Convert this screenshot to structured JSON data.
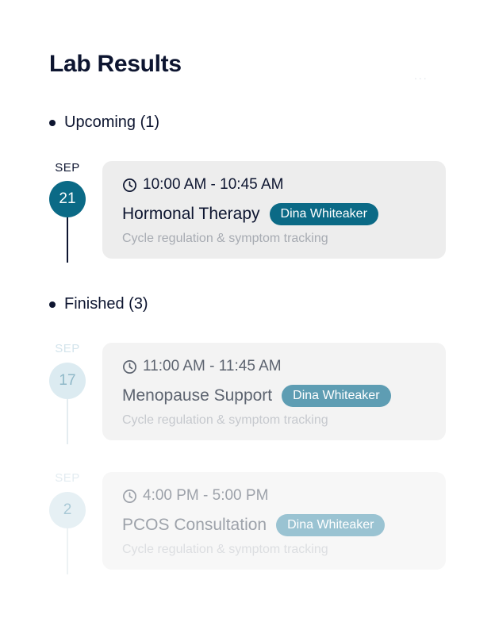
{
  "header": {
    "title": "Lab Results",
    "more_label": "..."
  },
  "sections": {
    "upcoming": {
      "label": "Upcoming (1)"
    },
    "finished": {
      "label": "Finished (3)"
    }
  },
  "appointments": [
    {
      "month": "SEP",
      "day": "21",
      "time": "10:00 AM - 10:45 AM",
      "name": "Hormonal Therapy",
      "doctor": "Dina Whiteaker",
      "description": "Cycle regulation & symptom tracking"
    },
    {
      "month": "SEP",
      "day": "17",
      "time": "11:00 AM - 11:45 AM",
      "name": "Menopause Support",
      "doctor": "Dina Whiteaker",
      "description": "Cycle regulation & symptom tracking"
    },
    {
      "month": "SEP",
      "day": "2",
      "time": "4:00 PM - 5:00 PM",
      "name": "PCOS Consultation",
      "doctor": "Dina Whiteaker",
      "description": "Cycle regulation & symptom tracking"
    }
  ],
  "colors": {
    "accent": "#0b6a86",
    "text_dark": "#0d1530",
    "card_bg": "#eeeeee",
    "muted": "#a7abb2"
  }
}
